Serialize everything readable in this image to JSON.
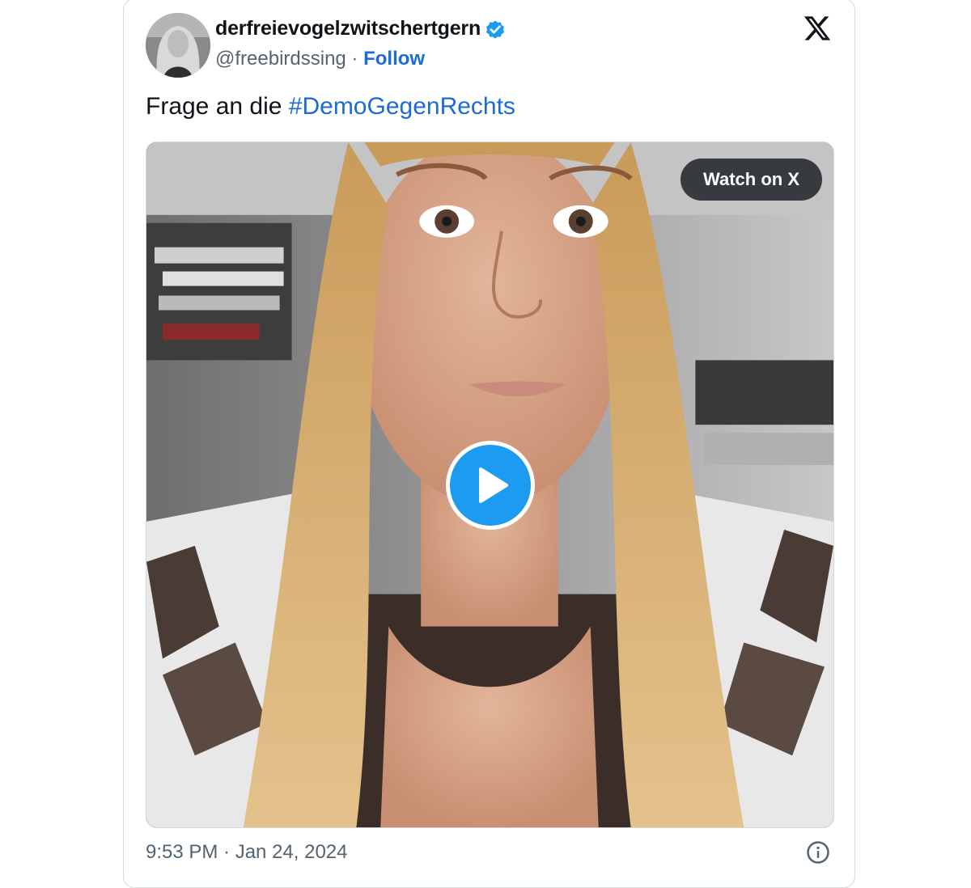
{
  "tweet": {
    "author": {
      "display_name": "derfreievogelzwitschertgern",
      "handle": "@freebirdssing",
      "separator": " · ",
      "follow_label": "Follow",
      "verified": true
    },
    "text_prefix": "Frage an die ",
    "hashtag": "#DemoGegenRechts",
    "media": {
      "type": "video",
      "watch_label": "Watch on X"
    },
    "timestamp": "9:53 PM · Jan 24, 2024"
  },
  "icons": {
    "brand": "x-logo-icon",
    "verified": "verified-badge-icon",
    "play": "play-icon",
    "info": "info-icon"
  },
  "colors": {
    "link": "#1d6bd3",
    "verified": "#1d9bf0",
    "play": "#1d9bf0",
    "text_primary": "#0f1419",
    "text_secondary": "#536471",
    "border": "#cfd9de"
  }
}
